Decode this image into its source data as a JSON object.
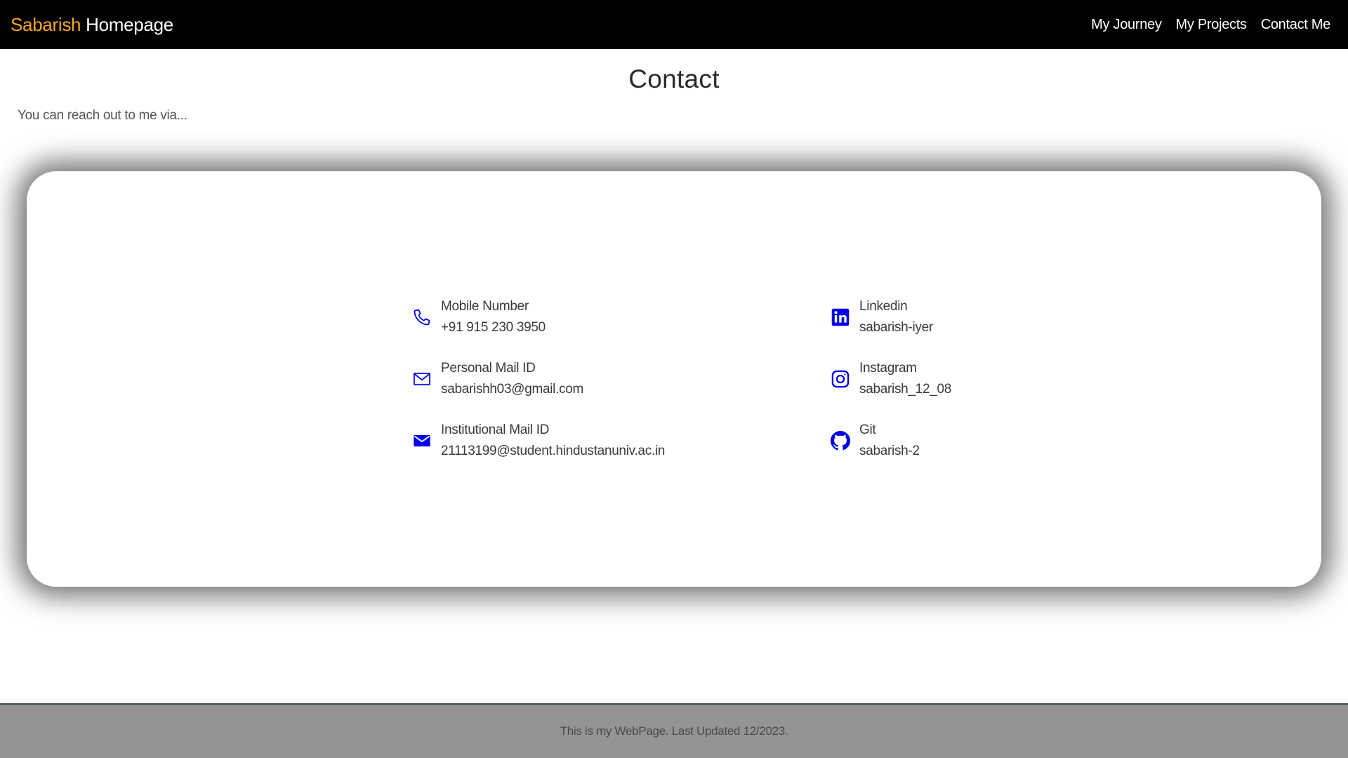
{
  "navbar": {
    "brand_first": "Sabarish",
    "brand_second": "Homepage",
    "links": [
      "My Journey",
      "My Projects",
      "Contact Me"
    ]
  },
  "page": {
    "title": "Contact",
    "intro": "You can reach out to me via..."
  },
  "contacts": {
    "mobile": {
      "label": "Mobile Number",
      "value": "+91 915 230 3950",
      "icon": "phone-icon"
    },
    "personal_mail": {
      "label": "Personal Mail ID",
      "value": "sabarishh03@gmail.com",
      "icon": "mail-outline-icon"
    },
    "institutional_mail": {
      "label": "Institutional Mail ID",
      "value": "21113199@student.hindustanuniv.ac.in",
      "icon": "mail-filled-icon"
    },
    "linkedin": {
      "label": "Linkedin",
      "value": "sabarish-iyer",
      "icon": "linkedin-icon"
    },
    "instagram": {
      "label": "Instagram",
      "value": "sabarish_12_08",
      "icon": "instagram-icon"
    },
    "git": {
      "label": "Git",
      "value": "sabarish-2",
      "icon": "github-icon"
    }
  },
  "footer": {
    "text": "This is my WebPage. Last Updated 12/2023."
  },
  "colors": {
    "navbar_bg": "#000000",
    "brand_accent": "#f5a623",
    "icon_color": "#0000ee",
    "footer_bg": "#949494"
  }
}
